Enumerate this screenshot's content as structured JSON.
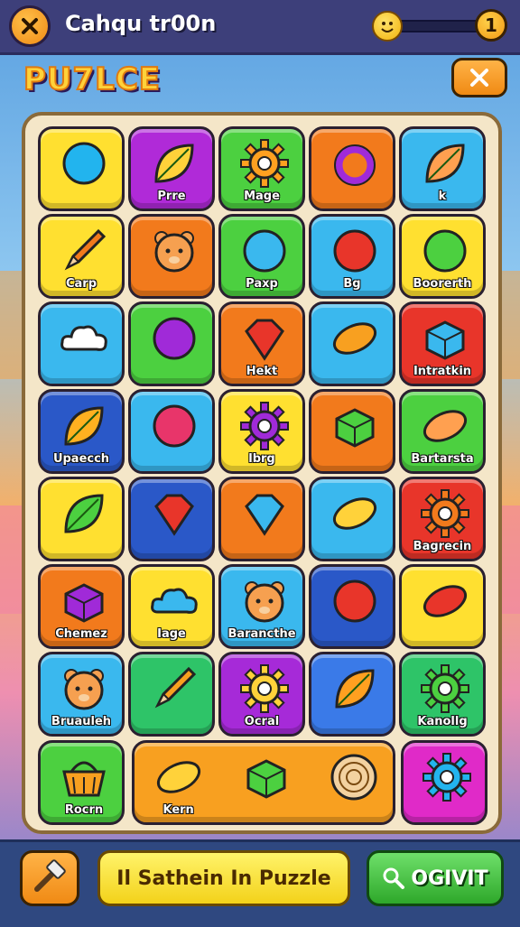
{
  "header": {
    "title": "Cahqu tr00n",
    "level": "1",
    "progress": 0.0
  },
  "subheader": {
    "title": "PU7LCE"
  },
  "grid": [
    {
      "label": "",
      "icon": "blue-ball-icon",
      "bg": "#ffe030"
    },
    {
      "label": "Prre",
      "icon": "leaf-swirl-icon",
      "bg": "#b02ad8"
    },
    {
      "label": "Mage",
      "icon": "gear-icon",
      "bg": "#4cd040"
    },
    {
      "label": "",
      "icon": "ring-icon",
      "bg": "#f27a1c"
    },
    {
      "label": "k",
      "icon": "wing-icon",
      "bg": "#3ab8ee"
    },
    {
      "label": "Carp",
      "icon": "pencil-icon",
      "bg": "#ffe030"
    },
    {
      "label": "",
      "icon": "bear-icon",
      "bg": "#f27a1c"
    },
    {
      "label": "Paxp",
      "icon": "magnifier-icon",
      "bg": "#4cd040"
    },
    {
      "label": "Bg",
      "icon": "apple-icon",
      "bg": "#3ab8ee"
    },
    {
      "label": "Boorerth",
      "icon": "green-ball-icon",
      "bg": "#ffe030"
    },
    {
      "label": "",
      "icon": "cloud-icon",
      "bg": "#3ab8ee"
    },
    {
      "label": "",
      "icon": "purple-balloon-icon",
      "bg": "#4cd040"
    },
    {
      "label": "Hekt",
      "icon": "heart-bowl-icon",
      "bg": "#f27a1c"
    },
    {
      "label": "",
      "icon": "bread-icon",
      "bg": "#3ab8ee"
    },
    {
      "label": "Intratkin",
      "icon": "block-icon",
      "bg": "#e8352a"
    },
    {
      "label": "Upaecch",
      "icon": "star-swoosh-icon",
      "bg": "#2a58c8"
    },
    {
      "label": "",
      "icon": "joystick-icon",
      "bg": "#3ab8ee"
    },
    {
      "label": "lbrg",
      "icon": "purple-gear-icon",
      "bg": "#ffe030"
    },
    {
      "label": "",
      "icon": "green-box-icon",
      "bg": "#f27a1c"
    },
    {
      "label": "Bartarsta",
      "icon": "shell-icon",
      "bg": "#4cd040"
    },
    {
      "label": "",
      "icon": "leaf-icon",
      "bg": "#ffe030"
    },
    {
      "label": "",
      "icon": "heart-gem-icon",
      "bg": "#2a58c8"
    },
    {
      "label": "",
      "icon": "kite-icon",
      "bg": "#f27a1c"
    },
    {
      "label": "",
      "icon": "feather-icon",
      "bg": "#3ab8ee"
    },
    {
      "label": "Bagrecin",
      "icon": "red-gear-icon",
      "bg": "#e8352a"
    },
    {
      "label": "Chemez",
      "icon": "camera-icon",
      "bg": "#f27a1c"
    },
    {
      "label": "Iage",
      "icon": "splash-icon",
      "bg": "#ffe030"
    },
    {
      "label": "Barancthe",
      "icon": "bear-face-icon",
      "bg": "#3ab8ee"
    },
    {
      "label": "",
      "icon": "berries-icon",
      "bg": "#2a58c8"
    },
    {
      "label": "",
      "icon": "microphone-icon",
      "bg": "#ffe030"
    },
    {
      "label": "Bruauleh",
      "icon": "bear-icon",
      "bg": "#3ab8ee"
    },
    {
      "label": "",
      "icon": "stick-icon",
      "bg": "#2ec468"
    },
    {
      "label": "Ocral",
      "icon": "sun-gear-icon",
      "bg": "#a62ad8"
    },
    {
      "label": "",
      "icon": "arrow-leaf-icon",
      "bg": "#3a7ae8"
    },
    {
      "label": "Kanollg",
      "icon": "green-gear-icon",
      "bg": "#2ec468"
    }
  ],
  "tray": {
    "items": [
      {
        "label": "Rocrn",
        "icon": "basket-icon",
        "bg": "#4cd040"
      },
      {
        "label": "Kern",
        "icon": "taco-icon",
        "bg": "#f8a020"
      },
      {
        "label": "",
        "icon": "green-cube-icon",
        "bg": "#f8a020"
      },
      {
        "label": "",
        "icon": "wood-slice-icon",
        "bg": "#f8a020"
      },
      {
        "label": "",
        "icon": "blue-gear-icon",
        "bg": "#e02ac8"
      }
    ]
  },
  "footer": {
    "search_label": "Il Sathein In Puzzle",
    "go_label": "OGIVIT"
  }
}
